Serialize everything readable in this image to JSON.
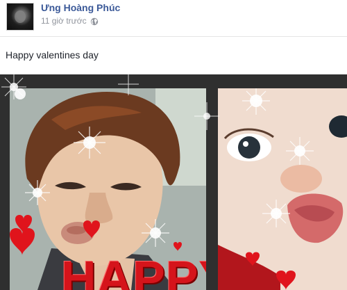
{
  "post": {
    "author": "Ưng Hoàng Phúc",
    "timestamp": "11 giờ trước",
    "privacy_icon": "globe-icon",
    "status_text": "Happy valentines day"
  },
  "photo": {
    "overlay_text": "HAPPY",
    "colors": {
      "frame": "#2f2f2f",
      "heart": "#e0141c",
      "text": "#d5141b"
    }
  }
}
